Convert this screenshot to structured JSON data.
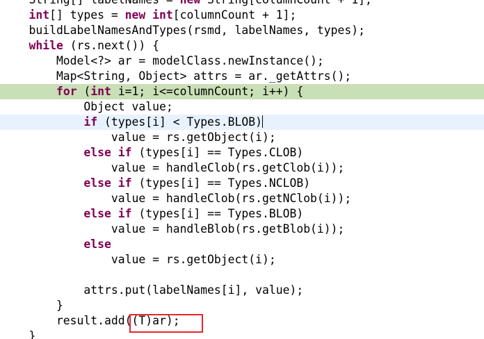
{
  "editor": {
    "lines": [
      [
        {
          "t": "    String[] labelNames = "
        },
        {
          "t": "new",
          "kw": true
        },
        {
          "t": " String[columnCount + 1];"
        }
      ],
      [
        {
          "t": "    "
        },
        {
          "t": "int",
          "kw": true
        },
        {
          "t": "[] types = "
        },
        {
          "t": "new",
          "kw": true
        },
        {
          "t": " "
        },
        {
          "t": "int",
          "kw": true
        },
        {
          "t": "[columnCount + 1];"
        }
      ],
      [
        {
          "t": "    buildLabelNamesAndTypes(rsmd, labelNames, types);"
        }
      ],
      [
        {
          "t": "    "
        },
        {
          "t": "while",
          "kw": true
        },
        {
          "t": " (rs.next()) {"
        }
      ],
      [
        {
          "t": "        Model<?> ar = modelClass.newInstance();"
        }
      ],
      [
        {
          "t": "        Map<String, Object> attrs = ar._getAttrs();"
        }
      ],
      [
        {
          "t": "        "
        },
        {
          "t": "for",
          "kw": true
        },
        {
          "t": " ("
        },
        {
          "t": "int",
          "kw": true
        },
        {
          "t": " i=1; i<=columnCount; i++) {"
        }
      ],
      [
        {
          "t": "            Object value;"
        }
      ],
      [
        {
          "t": "            "
        },
        {
          "t": "if",
          "kw": true
        },
        {
          "t": " (types[i] < Types.BLOB)"
        }
      ],
      [
        {
          "t": "                value = rs.getObject(i);"
        }
      ],
      [
        {
          "t": "            "
        },
        {
          "t": "else",
          "kw": true
        },
        {
          "t": " "
        },
        {
          "t": "if",
          "kw": true
        },
        {
          "t": " (types[i] == Types.CLOB)"
        }
      ],
      [
        {
          "t": "                value = handleClob(rs.getClob(i));"
        }
      ],
      [
        {
          "t": "            "
        },
        {
          "t": "else",
          "kw": true
        },
        {
          "t": " "
        },
        {
          "t": "if",
          "kw": true
        },
        {
          "t": " (types[i] == Types.NCLOB)"
        }
      ],
      [
        {
          "t": "                value = handleClob(rs.getNClob(i));"
        }
      ],
      [
        {
          "t": "            "
        },
        {
          "t": "else",
          "kw": true
        },
        {
          "t": " "
        },
        {
          "t": "if",
          "kw": true
        },
        {
          "t": " (types[i] == Types.BLOB)"
        }
      ],
      [
        {
          "t": "                value = handleBlob(rs.getBlob(i));"
        }
      ],
      [
        {
          "t": "            "
        },
        {
          "t": "else",
          "kw": true
        }
      ],
      [
        {
          "t": "                value = rs.getObject(i);"
        }
      ],
      [
        {
          "t": ""
        }
      ],
      [
        {
          "t": "            attrs.put(labelNames[i], value);"
        }
      ],
      [
        {
          "t": "        }"
        }
      ],
      [
        {
          "t": "        result.add((T)ar);"
        }
      ],
      [
        {
          "t": "    }"
        }
      ]
    ],
    "debug_line": 6,
    "current_line": 8,
    "colors": {
      "keyword": "#7f0055",
      "debug_highlight": "#c9dfb6",
      "current_line_highlight": "#e8f2fe",
      "annotation_border": "#e8242b"
    }
  }
}
